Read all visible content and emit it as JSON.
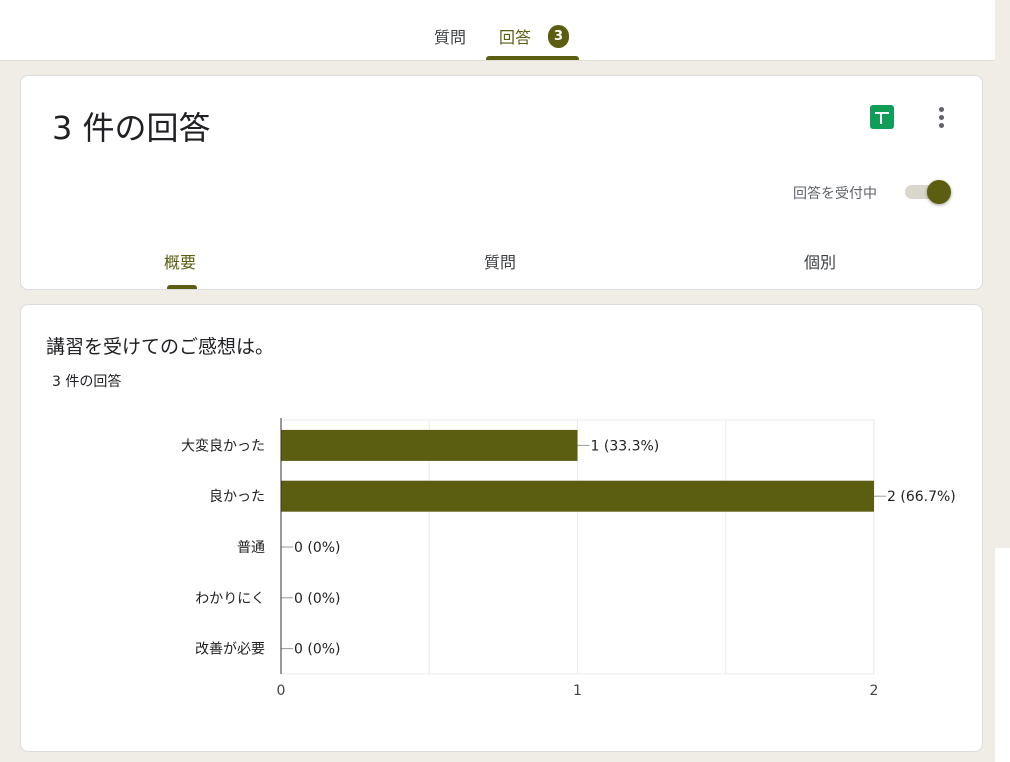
{
  "top_tabs": {
    "questions_label": "質問",
    "responses_label": "回答",
    "responses_count": "3"
  },
  "header": {
    "title": "3 件の回答",
    "accepting_label": "回答を受付中",
    "accepting_on": true,
    "sheets_icon": "google-sheets-icon",
    "more_icon": "more-vert-icon",
    "subtabs": {
      "summary": "概要",
      "question": "質問",
      "individual": "個別"
    }
  },
  "question_card": {
    "title": "講習を受けてのご感想は。",
    "response_count": "3 件の回答"
  },
  "colors": {
    "accent": "#5b5e10",
    "sheets_green": "#0f9d58"
  },
  "chart_data": {
    "type": "bar",
    "orientation": "horizontal",
    "categories": [
      "大変良かった",
      "良かった",
      "普通",
      "わかりにく",
      "改善が必要"
    ],
    "values": [
      1,
      2,
      0,
      0,
      0
    ],
    "value_labels": [
      "1 (33.3%)",
      "2 (66.7%)",
      "0 (0%)",
      "0 (0%)",
      "0 (0%)"
    ],
    "xlim": [
      0,
      2
    ],
    "x_ticks": [
      "0",
      "1",
      "2"
    ],
    "grid": true,
    "color": "#5b5e10"
  }
}
